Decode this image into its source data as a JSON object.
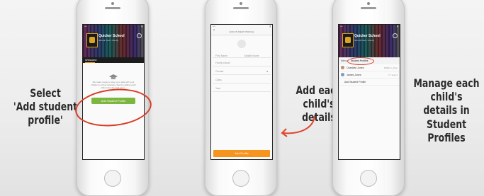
{
  "captions": {
    "select_line1": "Select",
    "select_line2": "'Add student profile'",
    "add_line1": "Add each",
    "add_line2": "child's details",
    "manage_line1": "Manage each",
    "manage_line2": "child's details in",
    "manage_line3": "Student Profiles"
  },
  "phone1": {
    "school_name": "Quicker School",
    "school_sub": "School Town, County",
    "tab_label": "Welcome",
    "body_text": "We make it easy to stay up to date with your children's school activities. Start by adding each child using their full name.",
    "button_label": "Add Student Profile"
  },
  "phone2": {
    "title": "ADD STUDENT PROFILE",
    "fields": [
      "First Name",
      "Middle Name",
      "Family Name",
      "Gender",
      "Class",
      "Year"
    ],
    "button_label": "Add Profile"
  },
  "phone3": {
    "school_name": "Quicker School",
    "school_sub": "School Town, County",
    "tab_menu": "Menu",
    "tab_profiles": "Student Profiles",
    "students": [
      {
        "name": "Charlotte Jones",
        "detail": "PREP in_Prep"
      },
      {
        "name": "James Jones",
        "detail": "Yr. Year 3"
      }
    ],
    "add_label": "Add Student Profile"
  },
  "colors": {
    "green_button": "#7cb63f",
    "orange_button": "#f7941d",
    "highlight_ring": "#d93a23"
  }
}
